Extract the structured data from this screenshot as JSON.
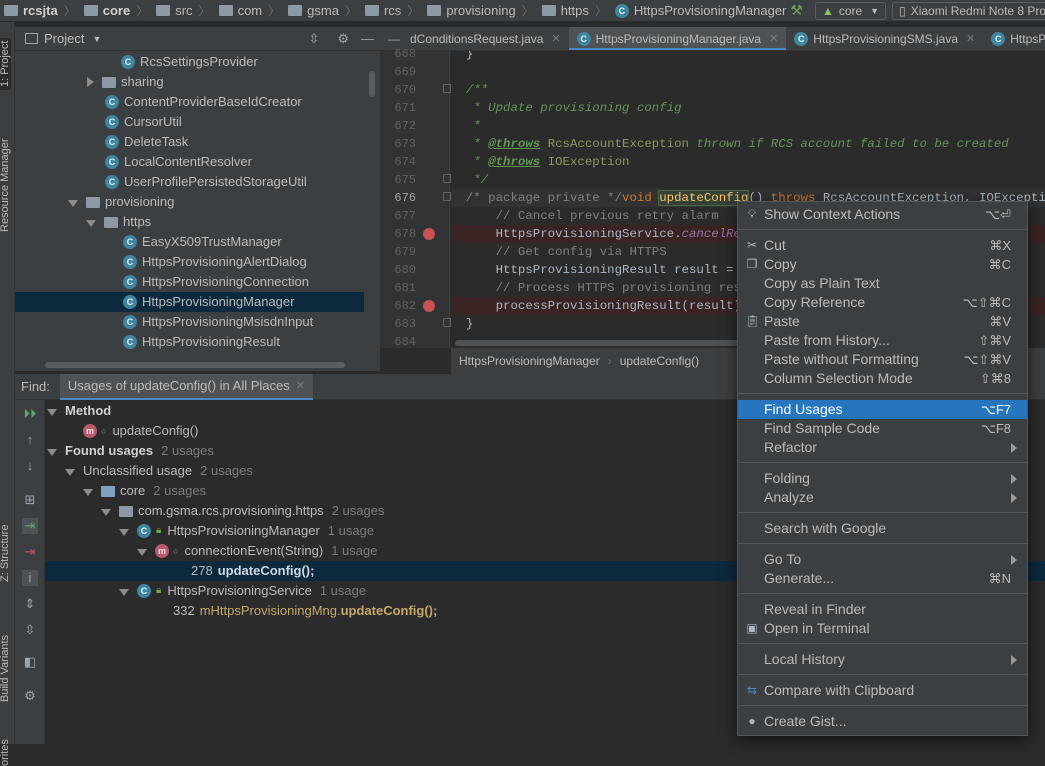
{
  "breadcrumb": [
    "rcsjta",
    "core",
    "src",
    "com",
    "gsma",
    "rcs",
    "provisioning",
    "https",
    "HttpsProvisioningManager"
  ],
  "toolbar": {
    "run_config": "core",
    "device": "Xiaomi Redmi Note 8 Pro"
  },
  "left_strip": {
    "project_tab": "1: Project",
    "resource_tab": "Resource Manager",
    "structure_tab": "Z: Structure",
    "build_tab": "Build Variants",
    "favorites_tab": "orites"
  },
  "project_panel": {
    "title": "Project"
  },
  "tree": [
    {
      "label": "RcsSettingsProvider",
      "kind": "class"
    },
    {
      "label": "sharing",
      "kind": "folder"
    },
    {
      "label": "ContentProviderBaseIdCreator",
      "kind": "class"
    },
    {
      "label": "CursorUtil",
      "kind": "class"
    },
    {
      "label": "DeleteTask",
      "kind": "class"
    },
    {
      "label": "LocalContentResolver",
      "kind": "class"
    },
    {
      "label": "UserProfilePersistedStorageUtil",
      "kind": "class"
    },
    {
      "label": "provisioning",
      "kind": "folder"
    },
    {
      "label": "https",
      "kind": "folder"
    },
    {
      "label": "EasyX509TrustManager",
      "kind": "class"
    },
    {
      "label": "HttpsProvisioningAlertDialog",
      "kind": "class"
    },
    {
      "label": "HttpsProvisioningConnection",
      "kind": "class"
    },
    {
      "label": "HttpsProvisioningManager",
      "kind": "class"
    },
    {
      "label": "HttpsProvisioningMsisdnInput",
      "kind": "class"
    },
    {
      "label": "HttpsProvisioningResult",
      "kind": "class"
    }
  ],
  "editor_tabs": [
    "dConditionsRequest.java",
    "HttpsProvisioningManager.java",
    "HttpsProvisioningSMS.java",
    "HttpsProvisioninc"
  ],
  "line_numbers": [
    "668",
    "669",
    "670",
    "671",
    "672",
    "673",
    "674",
    "675",
    "676",
    "677",
    "678",
    "679",
    "680",
    "681",
    "682",
    "683",
    "684"
  ],
  "code": {
    "l668": "  }",
    "l670": "  /**",
    "l671": "   * Update provisioning config",
    "l672": "   *",
    "l673_tag": "@throws",
    "l673_type": "RcsAccountException",
    "l673_text": " thrown if RCS account failed to be created",
    "l674_tag": "@throws",
    "l674_type": "IOException",
    "l675": "   */",
    "l676_cmt": "  /* package private */",
    "l676_kw": "void ",
    "l676_fn": "updateConfig",
    "l676_rest": "() ",
    "l676_throws": "throws ",
    "l676_ex": "RcsAccountException, IOException",
    "l677": "      // Cancel previous retry alarm",
    "l678_a": "      HttpsProvisioningService.",
    "l678_b": "cancelRe",
    "l679": "      // Get config via HTTPS",
    "l680": "      HttpsProvisioningResult result = ",
    "l681": "      // Process HTTPS provisioning res",
    "l682": "      processProvisioningResult(result)",
    "l683": "  }"
  },
  "code_breadcrumb": [
    "HttpsProvisioningManager",
    "updateConfig()"
  ],
  "find": {
    "label": "Find:",
    "tab": "Usages of updateConfig() in All Places",
    "rows": {
      "method_hdr": "Method",
      "method_name": "updateConfig()",
      "found_hdr": "Found usages",
      "found_cnt": "2 usages",
      "unclassified": "Unclassified usage",
      "unclassified_cnt": "2 usages",
      "core": "core",
      "core_cnt": "2 usages",
      "pkg": "com.gsma.rcs.provisioning.https",
      "pkg_cnt": "2 usages",
      "cls1": "HttpsProvisioningManager",
      "cls1_cnt": "1 usage",
      "meth1": "connectionEvent(String)",
      "meth1_cnt": "1 usage",
      "use1_line": "278",
      "use1_code": "updateConfig();",
      "cls2": "HttpsProvisioningService",
      "cls2_cnt": "1 usage",
      "use2_line": "332",
      "use2_prefix": "mHttpsProvisioningMng.",
      "use2_code": "updateConfig();"
    }
  },
  "context_menu": [
    {
      "label": "Show Context Actions",
      "shortcut": "⌥⏎",
      "icon": "bulb-icon"
    },
    {
      "sep": true
    },
    {
      "label": "Cut",
      "shortcut": "⌘X",
      "icon": "scissors-icon"
    },
    {
      "label": "Copy",
      "shortcut": "⌘C",
      "icon": "copy-icon"
    },
    {
      "label": "Copy as Plain Text",
      "shortcut": ""
    },
    {
      "label": "Copy Reference",
      "shortcut": "⌥⇧⌘C"
    },
    {
      "label": "Paste",
      "shortcut": "⌘V",
      "icon": "clipboard-icon"
    },
    {
      "label": "Paste from History...",
      "shortcut": "⇧⌘V"
    },
    {
      "label": "Paste without Formatting",
      "shortcut": "⌥⇧⌘V"
    },
    {
      "label": "Column Selection Mode",
      "shortcut": "⇧⌘8"
    },
    {
      "sep": true
    },
    {
      "label": "Find Usages",
      "shortcut": "⌥F7",
      "selected": true
    },
    {
      "label": "Find Sample Code",
      "shortcut": "⌥F8"
    },
    {
      "label": "Refactor",
      "submenu": true
    },
    {
      "sep": true
    },
    {
      "label": "Folding",
      "submenu": true
    },
    {
      "label": "Analyze",
      "submenu": true
    },
    {
      "sep": true
    },
    {
      "label": "Search with Google",
      "shortcut": ""
    },
    {
      "sep": true
    },
    {
      "label": "Go To",
      "submenu": true
    },
    {
      "label": "Generate...",
      "shortcut": "⌘N"
    },
    {
      "sep": true
    },
    {
      "label": "Reveal in Finder",
      "shortcut": ""
    },
    {
      "label": "Open in Terminal",
      "shortcut": "",
      "icon": "terminal-icon"
    },
    {
      "sep": true
    },
    {
      "label": "Local History",
      "submenu": true
    },
    {
      "sep": true
    },
    {
      "label": "Compare with Clipboard",
      "shortcut": "",
      "icon": "compare-icon"
    },
    {
      "sep": true
    },
    {
      "label": "Create Gist...",
      "shortcut": "",
      "icon": "github-icon"
    }
  ],
  "colors": {
    "selection": "#2675bf",
    "background": "#2b2b2b",
    "panel": "#3c3f41",
    "breakpoint": "#c75450"
  }
}
